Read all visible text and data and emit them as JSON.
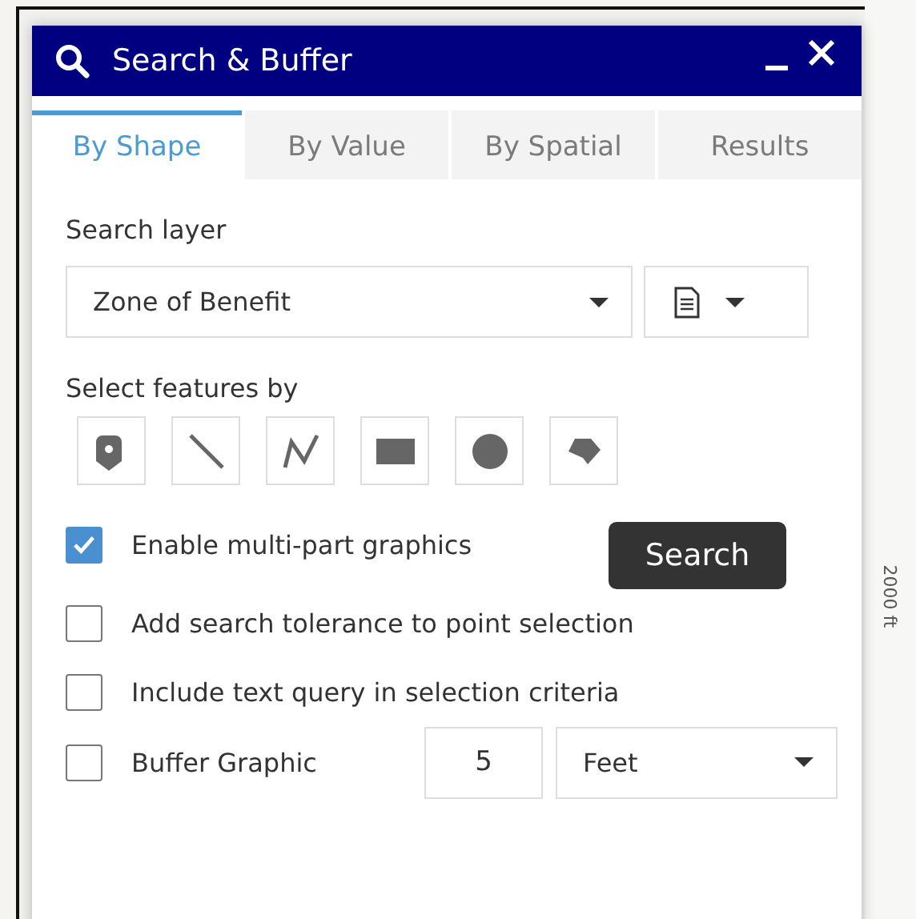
{
  "map": {
    "label": "2000 ft"
  },
  "window": {
    "title": "Search & Buffer"
  },
  "tabs": [
    {
      "label": "By Shape",
      "selected": true
    },
    {
      "label": "By Value",
      "selected": false
    },
    {
      "label": "By Spatial",
      "selected": false
    },
    {
      "label": "Results",
      "selected": false
    }
  ],
  "search_layer": {
    "label": "Search layer",
    "value": "Zone of Benefit"
  },
  "select_features": {
    "label": "Select features by",
    "tools": [
      {
        "kind": "point"
      },
      {
        "kind": "line"
      },
      {
        "kind": "polyline"
      },
      {
        "kind": "rectangle"
      },
      {
        "kind": "circle"
      },
      {
        "kind": "polygon"
      }
    ]
  },
  "options": [
    {
      "label": "Enable multi-part graphics",
      "checked": true
    },
    {
      "label": "Add search tolerance to point selection",
      "checked": false
    },
    {
      "label": "Include text query in selection criteria",
      "checked": false
    },
    {
      "label": "Buffer Graphic",
      "checked": false
    }
  ],
  "buffer": {
    "distance": "5",
    "unit": "Feet"
  },
  "tooltip": "Search"
}
